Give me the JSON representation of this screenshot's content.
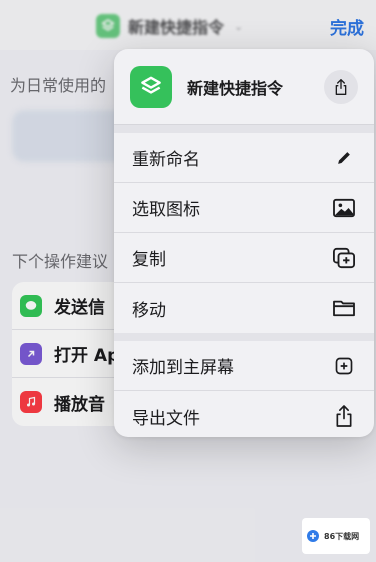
{
  "nav": {
    "title": "新建快捷指令",
    "done_label": "完成"
  },
  "background": {
    "hint_text": "为日常使用的",
    "section_label": "下个操作建议",
    "actions": [
      {
        "label": "发送信",
        "icon": "message-icon",
        "color": "#34c759"
      },
      {
        "label": "打开 Ap",
        "icon": "open-app-icon",
        "color": "#7b5bd6"
      },
      {
        "label": "播放音",
        "icon": "music-icon",
        "color": "#fc3c44"
      }
    ]
  },
  "menu": {
    "title": "新建快捷指令",
    "group1": [
      {
        "label": "重新命名",
        "icon": "pencil-icon"
      },
      {
        "label": "选取图标",
        "icon": "image-icon"
      },
      {
        "label": "复制",
        "icon": "duplicate-icon"
      },
      {
        "label": "移动",
        "icon": "folder-icon"
      }
    ],
    "group2": [
      {
        "label": "添加到主屏幕",
        "icon": "add-square-icon"
      },
      {
        "label": "导出文件",
        "icon": "share-icon"
      }
    ]
  },
  "watermark": {
    "text": "86下载网"
  }
}
